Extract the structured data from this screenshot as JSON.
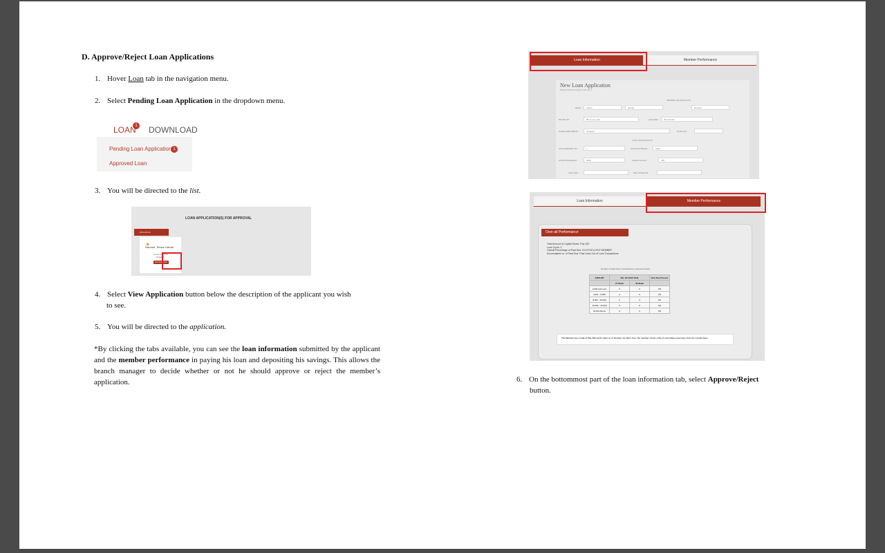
{
  "heading": "D. Approve/Reject Loan Applications",
  "steps": {
    "s1": {
      "num": "1.",
      "pre": "Hover ",
      "link": "Loan",
      "post": " tab in the navigation menu."
    },
    "s2": {
      "num": "2.",
      "pre": "Select ",
      "bold": "Pending Loan Application",
      "post": " in the dropdown menu."
    },
    "s3": {
      "num": "3.",
      "pre": "You will be directed to the ",
      "ital": "list."
    },
    "s4": {
      "num": "4.",
      "pre": "Select ",
      "bold": "View Application",
      "post": " button below the description of the applicant you wish",
      "line2": "to see."
    },
    "s5": {
      "num": "5.",
      "pre": "You will be directed to the ",
      "ital": "application."
    },
    "s6": {
      "num": "6.",
      "pre": "On the bottommost part of the loan information tab, select ",
      "bold": "Approve/Reject",
      "line2": "button."
    }
  },
  "note": {
    "pre": "*By clicking the tabs available, you can see the ",
    "b1": "loan information",
    "mid1": " submitted by the applicant and the ",
    "b2": "member performance",
    "post": " in paying his loan and depositing his savings. This allows the branch manager to decide whether or not he should approve or reject the member’s application."
  },
  "shot1": {
    "loan": "LOAN",
    "badge1": "1",
    "download": "DOWNLOAD",
    "pending": "Pending Loan Application",
    "badge2": "1",
    "approved": "Approved Loan"
  },
  "shot2": {
    "title": "LOAN APPLICATION(S) FOR APPROVAL",
    "date": "2014-10-16",
    "name": "Harvard, Shane Harold",
    "amount": "Amount: 2000 Php",
    "term": "25 Weeks",
    "button": "View Application"
  },
  "shot3": {
    "tab_active": "Loan Information",
    "tab_other": "Member Performance",
    "form_title": "New Loan Application",
    "form_sub": "Please fill all the inputs in the form",
    "member_info": "MEMBER INFORMATION",
    "loan_info": "LOAN INFORMATION",
    "labels": [
      "Name :",
      "Member ID :",
      "Caritas Salvo Branch :",
      "Loan Application No :",
      "Amount Requested :",
      "Loan Type :",
      "Loan Date :",
      "Center No. :",
      "Amount of Shares :",
      "Interest Income :",
      "Day of Payment :"
    ],
    "values": [
      "Shane",
      "Harold",
      "Harvard",
      "08-xx-xxx-y-all",
      "Tanauan",
      "1",
      "2000",
      "2014-10-16",
      "1000",
      "400"
    ]
  },
  "shot4": {
    "tab_other": "Loan Information",
    "tab_active": "Member Performance",
    "section": "Over-all Performance",
    "lines": [
      "Total Amount of Capital Share: Php 200",
      "Loan Cycle: 2",
      "Overall Percentage of Past Due: 0% EXCELLENT MEMBER",
      "Accumulated no. of Past Due: Past Dues Out of Loan Transactions"
    ],
    "table_caption": "Number of Past Due in accordance to amount loaned",
    "col_amount": "AMOUNT",
    "col_past": "NO. OF PAST DUE",
    "col_pct": "Past Due Percent",
    "col_w1": "27 Week",
    "col_w2": "40 Week",
    "rows": [
      [
        "4,000 and Less",
        "0",
        "0",
        "0%"
      ],
      [
        "4,001 - 8,000",
        "0",
        "0",
        "0%"
      ],
      [
        "8,001 - 16,000",
        "0",
        "0",
        "0%"
      ],
      [
        "16,001 - 32,000",
        "0",
        "0",
        "0%"
      ],
      [
        "32,001 Above",
        "0",
        "0",
        "0%"
      ]
    ],
    "footer": "The Member has a total of Php 200 worth share as of October 19, 2014. Also, the member shows a 0% of commiting a past due from his overall loans."
  },
  "colors": {
    "accent": "#a83222",
    "highlight": "#e02020"
  }
}
